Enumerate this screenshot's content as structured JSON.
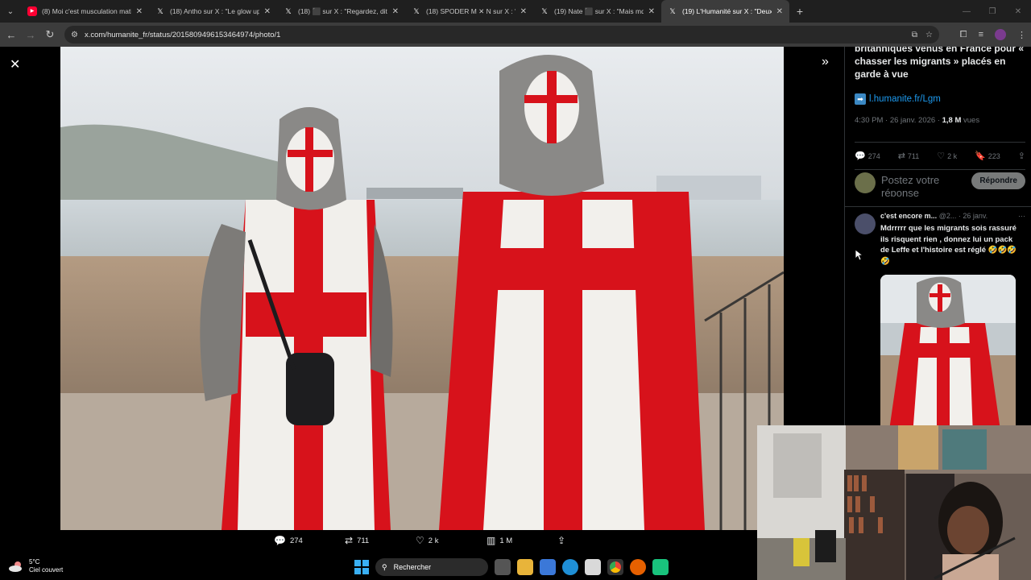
{
  "browser": {
    "tabs": [
      {
        "favicon": "youtube-icon",
        "title": "(8) Moi c'est musculation mati"
      },
      {
        "favicon": "x-icon",
        "title": "(18) Antho sur X : \"Le glow up d"
      },
      {
        "favicon": "x-icon",
        "title": "(18) ⬛ sur X : \"Regardez, dites"
      },
      {
        "favicon": "x-icon",
        "title": "(18) SPODER M ✕ N sur X : \"Ah"
      },
      {
        "favicon": "x-icon",
        "title": "(19) Nate ⬛ sur X : \"Mais mdr"
      },
      {
        "favicon": "x-icon",
        "title": "(19) L'Humanité sur X : \"Deux r"
      }
    ],
    "active_tab": 5,
    "url": "x.com/humanite_fr/status/2015809496153464974/photo/1"
  },
  "photo_view": {
    "actions": {
      "replies": "274",
      "reposts": "711",
      "likes": "2 k",
      "views": "1 M"
    }
  },
  "sidebar": {
    "post_text": "britanniques venus en France pour « chasser les migrants » placés en garde à vue",
    "link": "l.humanite.fr/Lgm",
    "time": "4:30 PM · 26 janv. 2026 · ",
    "views_count": "1,8 M",
    "views_label": " vues",
    "stats": {
      "replies": "274",
      "reposts": "711",
      "likes": "2 k",
      "bookmarks": "223"
    },
    "reply_placeholder": "Postez votre réponse",
    "reply_button": "Répondre",
    "reply": {
      "name": "c'est encore m...",
      "handle": "@2... · 26 janv.",
      "text": "Mdrrrrr que les migrants sois rassuré ils risquent rien , donnez lui un pack de Leffe et l'histoire est réglé 🤣🤣🤣🤣"
    }
  },
  "taskbar": {
    "temperature": "5°C",
    "weather": "Ciel couvert",
    "search_label": "Rechercher"
  }
}
